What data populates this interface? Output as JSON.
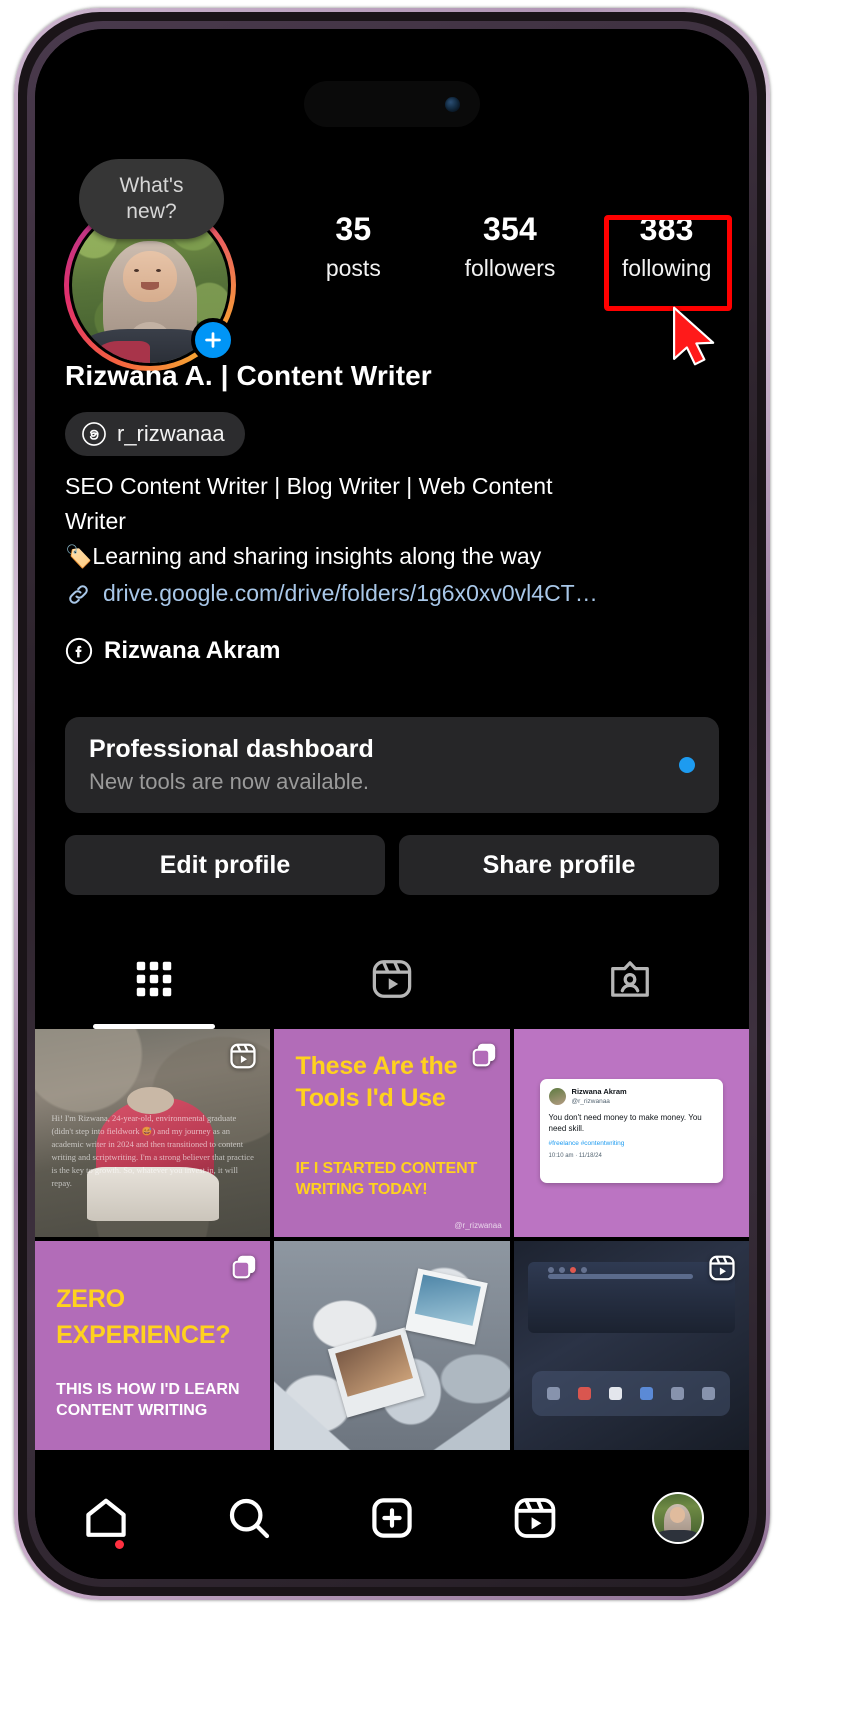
{
  "app": {
    "name": "Instagram",
    "theme": "dark"
  },
  "story_bubble": {
    "line1": "What's",
    "line2": "new?"
  },
  "profile": {
    "display_name": "Rizwana A. | Content Writer",
    "threads_handle": "r_rizwanaa",
    "bio_line1": "SEO Content Writer | Blog Writer | Web Content",
    "bio_line2": "Writer",
    "bio_emoji": "🏷️",
    "bio_line3": "Learning and sharing insights along the way",
    "link": "drive.google.com/drive/folders/1g6x0xv0vl4CT…",
    "facebook_name": "Rizwana Akram",
    "add_story_icon": "plus-icon",
    "threads_icon": "threads-icon",
    "link_icon": "link-icon",
    "facebook_icon": "facebook-icon"
  },
  "stats": [
    {
      "value": "35",
      "label": "posts",
      "name": "posts"
    },
    {
      "value": "354",
      "label": "followers",
      "name": "followers"
    },
    {
      "value": "383",
      "label": "following",
      "name": "following"
    }
  ],
  "annotation": {
    "highlight_color": "#ff0000",
    "cursor_color": "#ff1a1a",
    "target": "following"
  },
  "dashboard": {
    "title": "Professional dashboard",
    "subtitle": "New tools are now available.",
    "dot_color": "#1d9bf0"
  },
  "actions": {
    "edit_profile": "Edit profile",
    "share_profile": "Share profile"
  },
  "tabs": [
    {
      "name": "grid",
      "icon": "grid-icon",
      "active": true
    },
    {
      "name": "reels",
      "icon": "reels-icon",
      "active": false
    },
    {
      "name": "tagged",
      "icon": "tagged-icon",
      "active": false
    }
  ],
  "posts": [
    {
      "id": "post-1",
      "type": "reel",
      "badge": "reels-icon",
      "caption": "Hi! I'm Rizwana, 24-year-old, environmental graduate (didn't step into fieldwork 😅) and my journey as an academic writer in 2024 and then transitioned to content writing and scriptwriting. I'm a strong believer that practice is the key to growth. So, whatever you invest in, it will repay."
    },
    {
      "id": "post-2",
      "type": "carousel",
      "badge": "carousel-icon",
      "title": "These Are the Tools I'd Use",
      "subtitle": "IF I STARTED CONTENT WRITING TODAY!",
      "handle": "@r_rizwanaa",
      "bg_color": "#b26cb8",
      "text_color": "#ffd21e"
    },
    {
      "id": "post-3",
      "type": "image",
      "bg_color": "#bb74c2",
      "card": {
        "name": "Rizwana Akram",
        "username": "@r_rizwanaa",
        "body": "You don't need money to make money. You need skill.",
        "tags": "#freelance #contentwriting",
        "time": "10:10 am · 11/18/24"
      }
    },
    {
      "id": "post-4",
      "type": "carousel",
      "badge": "carousel-icon",
      "title": "ZERO EXPERIENCE?",
      "subtitle": "THIS IS HOW I'D LEARN CONTENT WRITING",
      "bg_color": "#b26cb8",
      "text_color": "#ffd21e"
    },
    {
      "id": "post-5",
      "type": "image",
      "description": "pile of printed photographs"
    },
    {
      "id": "post-6",
      "type": "reel",
      "badge": "reels-icon",
      "description": "laptop screen with editing timeline"
    }
  ],
  "bottom_nav": [
    {
      "name": "home",
      "icon": "home-icon",
      "active": true,
      "has_badge": true
    },
    {
      "name": "search",
      "icon": "search-icon",
      "active": false,
      "has_badge": false
    },
    {
      "name": "create",
      "icon": "plus-square-icon",
      "active": false,
      "has_badge": false
    },
    {
      "name": "reels",
      "icon": "reels-icon",
      "active": false,
      "has_badge": false
    },
    {
      "name": "profile",
      "icon": "avatar-icon",
      "active": false,
      "has_badge": false
    }
  ]
}
